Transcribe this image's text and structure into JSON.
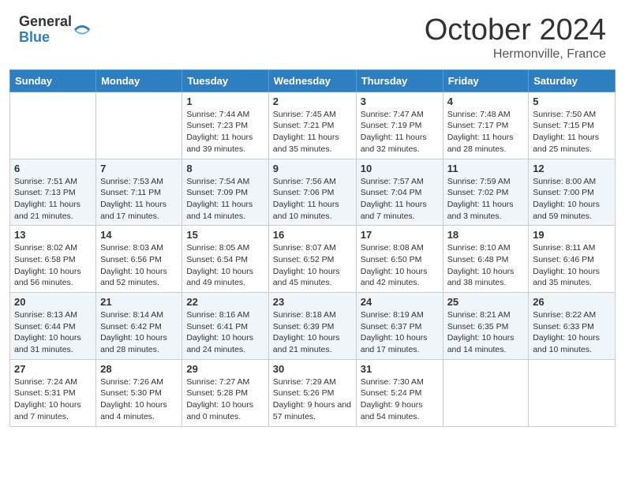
{
  "header": {
    "logo_general": "General",
    "logo_blue": "Blue",
    "month": "October 2024",
    "location": "Hermonville, France"
  },
  "days_of_week": [
    "Sunday",
    "Monday",
    "Tuesday",
    "Wednesday",
    "Thursday",
    "Friday",
    "Saturday"
  ],
  "weeks": [
    [
      {
        "day": "",
        "sunrise": "",
        "sunset": "",
        "daylight": ""
      },
      {
        "day": "",
        "sunrise": "",
        "sunset": "",
        "daylight": ""
      },
      {
        "day": "1",
        "sunrise": "Sunrise: 7:44 AM",
        "sunset": "Sunset: 7:23 PM",
        "daylight": "Daylight: 11 hours and 39 minutes."
      },
      {
        "day": "2",
        "sunrise": "Sunrise: 7:45 AM",
        "sunset": "Sunset: 7:21 PM",
        "daylight": "Daylight: 11 hours and 35 minutes."
      },
      {
        "day": "3",
        "sunrise": "Sunrise: 7:47 AM",
        "sunset": "Sunset: 7:19 PM",
        "daylight": "Daylight: 11 hours and 32 minutes."
      },
      {
        "day": "4",
        "sunrise": "Sunrise: 7:48 AM",
        "sunset": "Sunset: 7:17 PM",
        "daylight": "Daylight: 11 hours and 28 minutes."
      },
      {
        "day": "5",
        "sunrise": "Sunrise: 7:50 AM",
        "sunset": "Sunset: 7:15 PM",
        "daylight": "Daylight: 11 hours and 25 minutes."
      }
    ],
    [
      {
        "day": "6",
        "sunrise": "Sunrise: 7:51 AM",
        "sunset": "Sunset: 7:13 PM",
        "daylight": "Daylight: 11 hours and 21 minutes."
      },
      {
        "day": "7",
        "sunrise": "Sunrise: 7:53 AM",
        "sunset": "Sunset: 7:11 PM",
        "daylight": "Daylight: 11 hours and 17 minutes."
      },
      {
        "day": "8",
        "sunrise": "Sunrise: 7:54 AM",
        "sunset": "Sunset: 7:09 PM",
        "daylight": "Daylight: 11 hours and 14 minutes."
      },
      {
        "day": "9",
        "sunrise": "Sunrise: 7:56 AM",
        "sunset": "Sunset: 7:06 PM",
        "daylight": "Daylight: 11 hours and 10 minutes."
      },
      {
        "day": "10",
        "sunrise": "Sunrise: 7:57 AM",
        "sunset": "Sunset: 7:04 PM",
        "daylight": "Daylight: 11 hours and 7 minutes."
      },
      {
        "day": "11",
        "sunrise": "Sunrise: 7:59 AM",
        "sunset": "Sunset: 7:02 PM",
        "daylight": "Daylight: 11 hours and 3 minutes."
      },
      {
        "day": "12",
        "sunrise": "Sunrise: 8:00 AM",
        "sunset": "Sunset: 7:00 PM",
        "daylight": "Daylight: 10 hours and 59 minutes."
      }
    ],
    [
      {
        "day": "13",
        "sunrise": "Sunrise: 8:02 AM",
        "sunset": "Sunset: 6:58 PM",
        "daylight": "Daylight: 10 hours and 56 minutes."
      },
      {
        "day": "14",
        "sunrise": "Sunrise: 8:03 AM",
        "sunset": "Sunset: 6:56 PM",
        "daylight": "Daylight: 10 hours and 52 minutes."
      },
      {
        "day": "15",
        "sunrise": "Sunrise: 8:05 AM",
        "sunset": "Sunset: 6:54 PM",
        "daylight": "Daylight: 10 hours and 49 minutes."
      },
      {
        "day": "16",
        "sunrise": "Sunrise: 8:07 AM",
        "sunset": "Sunset: 6:52 PM",
        "daylight": "Daylight: 10 hours and 45 minutes."
      },
      {
        "day": "17",
        "sunrise": "Sunrise: 8:08 AM",
        "sunset": "Sunset: 6:50 PM",
        "daylight": "Daylight: 10 hours and 42 minutes."
      },
      {
        "day": "18",
        "sunrise": "Sunrise: 8:10 AM",
        "sunset": "Sunset: 6:48 PM",
        "daylight": "Daylight: 10 hours and 38 minutes."
      },
      {
        "day": "19",
        "sunrise": "Sunrise: 8:11 AM",
        "sunset": "Sunset: 6:46 PM",
        "daylight": "Daylight: 10 hours and 35 minutes."
      }
    ],
    [
      {
        "day": "20",
        "sunrise": "Sunrise: 8:13 AM",
        "sunset": "Sunset: 6:44 PM",
        "daylight": "Daylight: 10 hours and 31 minutes."
      },
      {
        "day": "21",
        "sunrise": "Sunrise: 8:14 AM",
        "sunset": "Sunset: 6:42 PM",
        "daylight": "Daylight: 10 hours and 28 minutes."
      },
      {
        "day": "22",
        "sunrise": "Sunrise: 8:16 AM",
        "sunset": "Sunset: 6:41 PM",
        "daylight": "Daylight: 10 hours and 24 minutes."
      },
      {
        "day": "23",
        "sunrise": "Sunrise: 8:18 AM",
        "sunset": "Sunset: 6:39 PM",
        "daylight": "Daylight: 10 hours and 21 minutes."
      },
      {
        "day": "24",
        "sunrise": "Sunrise: 8:19 AM",
        "sunset": "Sunset: 6:37 PM",
        "daylight": "Daylight: 10 hours and 17 minutes."
      },
      {
        "day": "25",
        "sunrise": "Sunrise: 8:21 AM",
        "sunset": "Sunset: 6:35 PM",
        "daylight": "Daylight: 10 hours and 14 minutes."
      },
      {
        "day": "26",
        "sunrise": "Sunrise: 8:22 AM",
        "sunset": "Sunset: 6:33 PM",
        "daylight": "Daylight: 10 hours and 10 minutes."
      }
    ],
    [
      {
        "day": "27",
        "sunrise": "Sunrise: 7:24 AM",
        "sunset": "Sunset: 5:31 PM",
        "daylight": "Daylight: 10 hours and 7 minutes."
      },
      {
        "day": "28",
        "sunrise": "Sunrise: 7:26 AM",
        "sunset": "Sunset: 5:30 PM",
        "daylight": "Daylight: 10 hours and 4 minutes."
      },
      {
        "day": "29",
        "sunrise": "Sunrise: 7:27 AM",
        "sunset": "Sunset: 5:28 PM",
        "daylight": "Daylight: 10 hours and 0 minutes."
      },
      {
        "day": "30",
        "sunrise": "Sunrise: 7:29 AM",
        "sunset": "Sunset: 5:26 PM",
        "daylight": "Daylight: 9 hours and 57 minutes."
      },
      {
        "day": "31",
        "sunrise": "Sunrise: 7:30 AM",
        "sunset": "Sunset: 5:24 PM",
        "daylight": "Daylight: 9 hours and 54 minutes."
      },
      {
        "day": "",
        "sunrise": "",
        "sunset": "",
        "daylight": ""
      },
      {
        "day": "",
        "sunrise": "",
        "sunset": "",
        "daylight": ""
      }
    ]
  ]
}
